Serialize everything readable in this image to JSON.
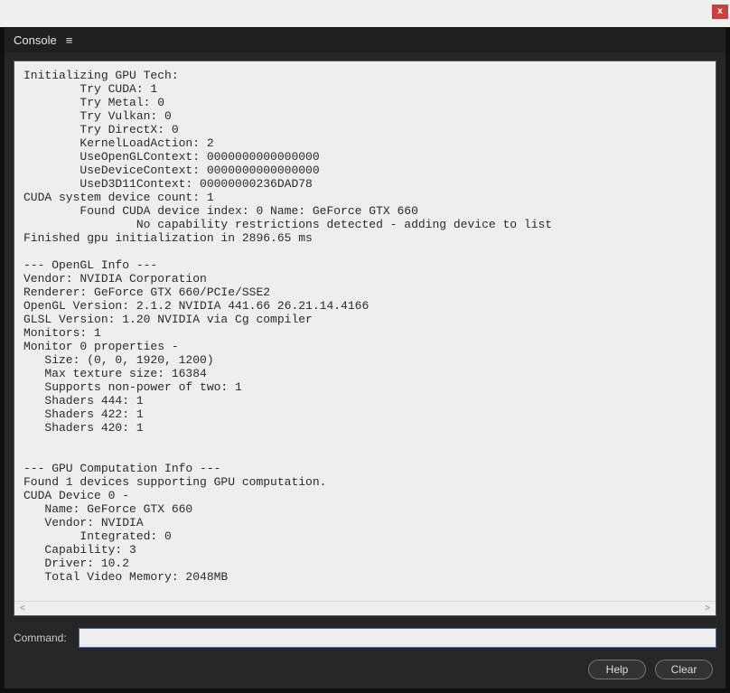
{
  "window": {
    "close_glyph": "x"
  },
  "tab": {
    "label": "Console",
    "menu_glyph": "≡"
  },
  "console": {
    "output": "Initializing GPU Tech:\n        Try CUDA: 1\n        Try Metal: 0\n        Try Vulkan: 0\n        Try DirectX: 0\n        KernelLoadAction: 2\n        UseOpenGLContext: 0000000000000000\n        UseDeviceContext: 0000000000000000\n        UseD3D11Context: 00000000236DAD78\nCUDA system device count: 1\n        Found CUDA device index: 0 Name: GeForce GTX 660\n                No capability restrictions detected - adding device to list\nFinished gpu initialization in 2896.65 ms\n\n--- OpenGL Info ---\nVendor: NVIDIA Corporation\nRenderer: GeForce GTX 660/PCIe/SSE2\nOpenGL Version: 2.1.2 NVIDIA 441.66 26.21.14.4166\nGLSL Version: 1.20 NVIDIA via Cg compiler\nMonitors: 1\nMonitor 0 properties -\n   Size: (0, 0, 1920, 1200)\n   Max texture size: 16384\n   Supports non-power of two: 1\n   Shaders 444: 1\n   Shaders 422: 1\n   Shaders 420: 1\n\n\n--- GPU Computation Info ---\nFound 1 devices supporting GPU computation.\nCUDA Device 0 -\n   Name: GeForce GTX 660\n   Vendor: NVIDIA\n        Integrated: 0\n   Capability: 3\n   Driver: 10.2\n   Total Video Memory: 2048MB",
    "h_scroll_left": "<",
    "h_scroll_right": ">"
  },
  "command": {
    "label": "Command:",
    "value": "",
    "placeholder": ""
  },
  "buttons": {
    "help": "Help",
    "clear": "Clear"
  }
}
